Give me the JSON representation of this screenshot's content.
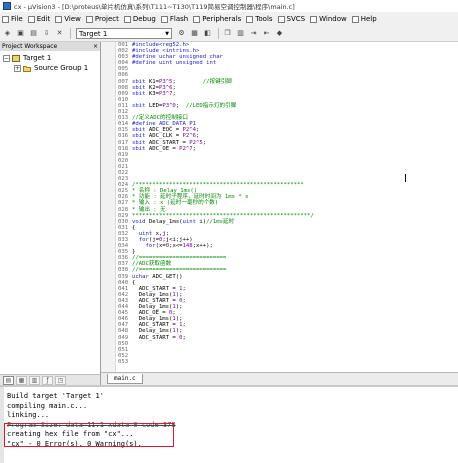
{
  "window": {
    "title": "cx - µVision3 - [D:\\proteus\\单片机仿真\\系列\\T111~T130\\T119简易空调控制器\\程序\\main.c]"
  },
  "menu": [
    {
      "label": "File",
      "accel": "F"
    },
    {
      "label": "Edit",
      "accel": "E"
    },
    {
      "label": "View",
      "accel": "V"
    },
    {
      "label": "Project",
      "accel": "P"
    },
    {
      "label": "Debug",
      "accel": "D"
    },
    {
      "label": "Flash",
      "accel": "l"
    },
    {
      "label": "Peripherals",
      "accel": "e"
    },
    {
      "label": "Tools",
      "accel": "T"
    },
    {
      "label": "SVCS",
      "accel": "S"
    },
    {
      "label": "Window",
      "accel": "W"
    },
    {
      "label": "Help",
      "accel": "H"
    }
  ],
  "toolbar": {
    "target_value": "Target 1"
  },
  "workspace": {
    "header": "Project Workspace",
    "close": "×",
    "tree": [
      {
        "label": "Target 1",
        "expander": "−",
        "level": 0
      },
      {
        "label": "Source Group 1",
        "expander": "+",
        "level": 1
      }
    ],
    "tabs": [
      "Files",
      "Regs",
      "Books",
      "Functions",
      "Templates"
    ]
  },
  "editor": {
    "lines": [
      {
        "n": "001",
        "segs": [
          {
            "c": "pp",
            "t": "#include<reg52.h>"
          }
        ]
      },
      {
        "n": "002",
        "segs": [
          {
            "c": "pp",
            "t": "#include <intrins.h>"
          }
        ]
      },
      {
        "n": "003",
        "segs": [
          {
            "c": "pp",
            "t": "#define uchar unsigned char"
          }
        ]
      },
      {
        "n": "004",
        "segs": [
          {
            "c": "pp",
            "t": "#define uint unsigned int"
          }
        ]
      },
      {
        "n": "005",
        "segs": []
      },
      {
        "n": "006",
        "segs": []
      },
      {
        "n": "007",
        "segs": [
          {
            "c": "kw",
            "t": "sbit"
          },
          {
            "c": "tx",
            "t": " K1="
          },
          {
            "c": "nm",
            "t": "P3^5"
          },
          {
            "c": "tx",
            "t": ";        "
          },
          {
            "c": "cm",
            "t": "//按键引脚"
          }
        ]
      },
      {
        "n": "008",
        "segs": [
          {
            "c": "kw",
            "t": "sbit"
          },
          {
            "c": "tx",
            "t": " K2="
          },
          {
            "c": "nm",
            "t": "P3^6"
          },
          {
            "c": "tx",
            "t": ";"
          }
        ]
      },
      {
        "n": "009",
        "segs": [
          {
            "c": "kw",
            "t": "sbit"
          },
          {
            "c": "tx",
            "t": " K3="
          },
          {
            "c": "nm",
            "t": "P3^7"
          },
          {
            "c": "tx",
            "t": ";"
          }
        ]
      },
      {
        "n": "010",
        "segs": []
      },
      {
        "n": "011",
        "segs": [
          {
            "c": "kw",
            "t": "sbit"
          },
          {
            "c": "tx",
            "t": " LED="
          },
          {
            "c": "nm",
            "t": "P3^0"
          },
          {
            "c": "tx",
            "t": ";  "
          },
          {
            "c": "cm",
            "t": "//LED指示灯的引脚"
          }
        ]
      },
      {
        "n": "012",
        "segs": []
      },
      {
        "n": "013",
        "segs": [
          {
            "c": "cm",
            "t": "//定义ADC的控制接口"
          }
        ]
      },
      {
        "n": "014",
        "segs": [
          {
            "c": "pp",
            "t": "#define ADC_DATA P1"
          }
        ]
      },
      {
        "n": "015",
        "segs": [
          {
            "c": "kw",
            "t": "sbit"
          },
          {
            "c": "tx",
            "t": " ADC_EOC = "
          },
          {
            "c": "nm",
            "t": "P2^4"
          },
          {
            "c": "tx",
            "t": ";"
          }
        ]
      },
      {
        "n": "016",
        "segs": [
          {
            "c": "kw",
            "t": "sbit"
          },
          {
            "c": "tx",
            "t": " ADC_CLK = "
          },
          {
            "c": "nm",
            "t": "P2^6"
          },
          {
            "c": "tx",
            "t": ";"
          }
        ]
      },
      {
        "n": "017",
        "segs": [
          {
            "c": "kw",
            "t": "sbit"
          },
          {
            "c": "tx",
            "t": " ADC_START = "
          },
          {
            "c": "nm",
            "t": "P2^5"
          },
          {
            "c": "tx",
            "t": ";"
          }
        ]
      },
      {
        "n": "018",
        "segs": [
          {
            "c": "kw",
            "t": "sbit"
          },
          {
            "c": "tx",
            "t": " ADC_OE = "
          },
          {
            "c": "nm",
            "t": "P2^7"
          },
          {
            "c": "tx",
            "t": ";"
          }
        ]
      },
      {
        "n": "019",
        "segs": []
      },
      {
        "n": "020",
        "segs": []
      },
      {
        "n": "021",
        "segs": []
      },
      {
        "n": "022",
        "segs": []
      },
      {
        "n": "023",
        "segs": []
      },
      {
        "n": "024",
        "segs": [
          {
            "c": "cm",
            "t": "/**************************************************"
          }
        ]
      },
      {
        "n": "025",
        "segs": [
          {
            "c": "cm",
            "t": "* 名称 : Delay_1ms()"
          }
        ]
      },
      {
        "n": "026",
        "segs": [
          {
            "c": "cm",
            "t": "* 功能 : 延时子程序，延时时间为 1ms * x"
          }
        ]
      },
      {
        "n": "027",
        "segs": [
          {
            "c": "cm",
            "t": "* 输入 : x (延时一毫秒的个数)"
          }
        ]
      },
      {
        "n": "028",
        "segs": [
          {
            "c": "cm",
            "t": "* 输出 : 无"
          }
        ]
      },
      {
        "n": "029",
        "segs": [
          {
            "c": "cm",
            "t": "*****************************************************/"
          }
        ]
      },
      {
        "n": "030",
        "segs": [
          {
            "c": "kw",
            "t": "void"
          },
          {
            "c": "tx",
            "t": " Delay_1ms("
          },
          {
            "c": "kw",
            "t": "uint"
          },
          {
            "c": "tx",
            "t": " i)"
          },
          {
            "c": "cm",
            "t": "//1ms延时"
          }
        ]
      },
      {
        "n": "031",
        "segs": [
          {
            "c": "tx",
            "t": "{"
          }
        ]
      },
      {
        "n": "032",
        "segs": [
          {
            "c": "tx",
            "t": "  "
          },
          {
            "c": "kw",
            "t": "uint"
          },
          {
            "c": "tx",
            "t": " x,j;"
          }
        ]
      },
      {
        "n": "033",
        "segs": [
          {
            "c": "tx",
            "t": "  "
          },
          {
            "c": "kw",
            "t": "for"
          },
          {
            "c": "tx",
            "t": "(j="
          },
          {
            "c": "nm",
            "t": "0"
          },
          {
            "c": "tx",
            "t": ";j<i;j++)"
          }
        ]
      },
      {
        "n": "034",
        "segs": [
          {
            "c": "tx",
            "t": "    "
          },
          {
            "c": "kw",
            "t": "for"
          },
          {
            "c": "tx",
            "t": "(x="
          },
          {
            "c": "nm",
            "t": "0"
          },
          {
            "c": "tx",
            "t": ";x<="
          },
          {
            "c": "nm",
            "t": "148"
          },
          {
            "c": "tx",
            "t": ";x++);"
          }
        ]
      },
      {
        "n": "035",
        "segs": [
          {
            "c": "tx",
            "t": "}"
          }
        ]
      },
      {
        "n": "036",
        "segs": [
          {
            "c": "cm",
            "t": "//=========================="
          }
        ]
      },
      {
        "n": "037",
        "segs": [
          {
            "c": "cm",
            "t": "//ADC获取函数"
          }
        ]
      },
      {
        "n": "038",
        "segs": [
          {
            "c": "cm",
            "t": "//=========================="
          }
        ]
      },
      {
        "n": "039",
        "segs": [
          {
            "c": "kw",
            "t": "uchar"
          },
          {
            "c": "tx",
            "t": " ADC_GET()"
          }
        ]
      },
      {
        "n": "040",
        "segs": [
          {
            "c": "tx",
            "t": "{"
          }
        ]
      },
      {
        "n": "041",
        "segs": [
          {
            "c": "tx",
            "t": "  ADC_START = "
          },
          {
            "c": "nm",
            "t": "1"
          },
          {
            "c": "tx",
            "t": ";"
          }
        ]
      },
      {
        "n": "042",
        "segs": [
          {
            "c": "tx",
            "t": "  Delay_1ms("
          },
          {
            "c": "nm",
            "t": "1"
          },
          {
            "c": "tx",
            "t": ");"
          }
        ]
      },
      {
        "n": "043",
        "segs": [
          {
            "c": "tx",
            "t": "  ADC_START = "
          },
          {
            "c": "nm",
            "t": "0"
          },
          {
            "c": "tx",
            "t": ";"
          }
        ]
      },
      {
        "n": "044",
        "segs": [
          {
            "c": "tx",
            "t": "  Delay_1ms("
          },
          {
            "c": "nm",
            "t": "1"
          },
          {
            "c": "tx",
            "t": ");"
          }
        ]
      },
      {
        "n": "045",
        "segs": [
          {
            "c": "tx",
            "t": "  ADC_OE = "
          },
          {
            "c": "nm",
            "t": "0"
          },
          {
            "c": "tx",
            "t": ";"
          }
        ]
      },
      {
        "n": "046",
        "segs": [
          {
            "c": "tx",
            "t": "  Delay_1ms("
          },
          {
            "c": "nm",
            "t": "1"
          },
          {
            "c": "tx",
            "t": ");"
          }
        ]
      },
      {
        "n": "047",
        "segs": [
          {
            "c": "tx",
            "t": "  ADC_START = "
          },
          {
            "c": "nm",
            "t": "1"
          },
          {
            "c": "tx",
            "t": ";"
          }
        ]
      },
      {
        "n": "048",
        "segs": [
          {
            "c": "tx",
            "t": "  Delay_1ms("
          },
          {
            "c": "nm",
            "t": "1"
          },
          {
            "c": "tx",
            "t": ");"
          }
        ]
      },
      {
        "n": "049",
        "segs": [
          {
            "c": "tx",
            "t": "  ADC_START = "
          },
          {
            "c": "nm",
            "t": "0"
          },
          {
            "c": "tx",
            "t": ";"
          }
        ]
      },
      {
        "n": "050",
        "segs": []
      },
      {
        "n": "051",
        "segs": []
      },
      {
        "n": "052",
        "segs": []
      },
      {
        "n": "053",
        "segs": []
      }
    ],
    "tab_label": "main.c"
  },
  "build": {
    "lines": [
      {
        "text": "Build target 'Target 1'",
        "strike": false
      },
      {
        "text": "compiling main.c...",
        "strike": false
      },
      {
        "text": "linking...",
        "strike": false
      },
      {
        "text": "Program Size: data=11.1 xdata=0 code=378",
        "strike": true
      },
      {
        "text": "creating hex file from \"cx\"...",
        "strike": false
      },
      {
        "text": "\"cx\" - 0 Error(s), 0 Warning(s).",
        "strike": false
      }
    ]
  },
  "colors": {
    "highlight_box": "#e0182a",
    "comment": "#008a00",
    "keyword": "#1a1ad6"
  }
}
